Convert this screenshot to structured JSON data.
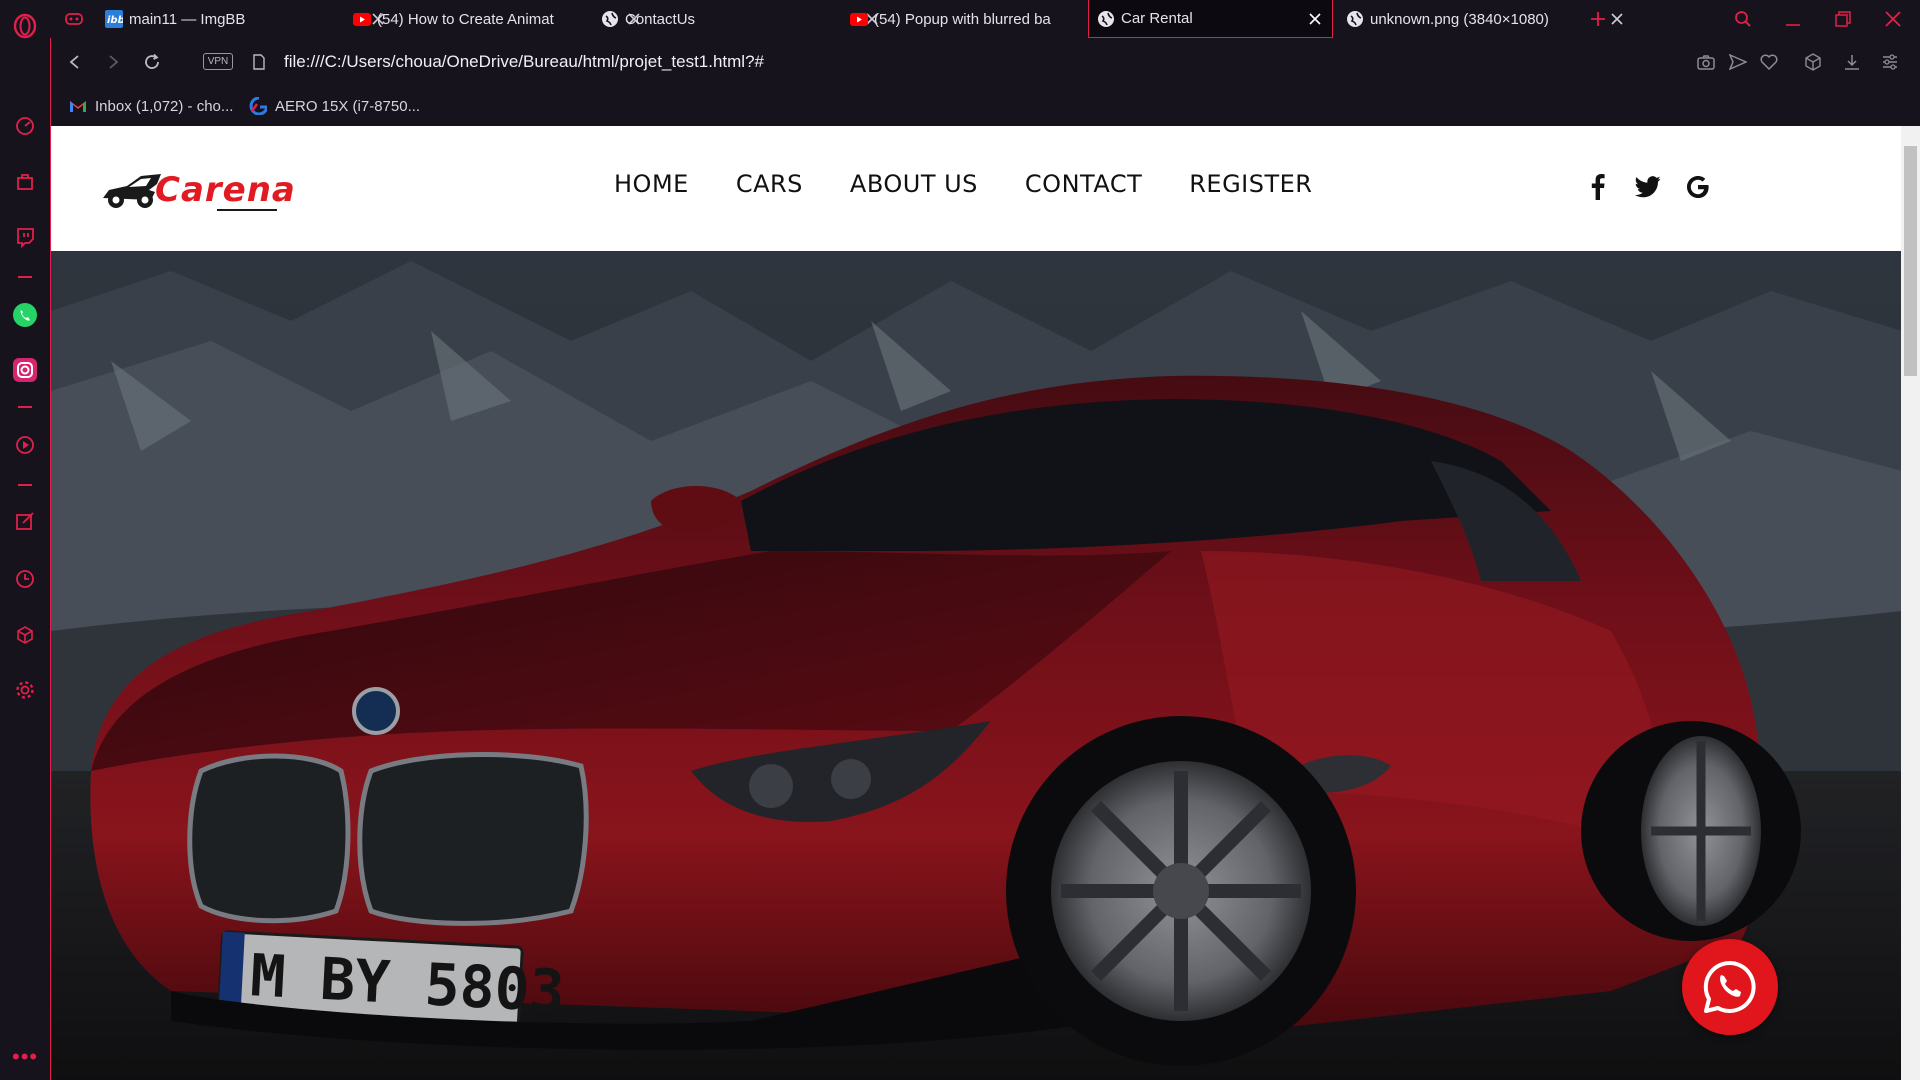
{
  "browser": {
    "tabs": [
      {
        "title": "main11 — ImgBB",
        "icon": "imgbb-icon"
      },
      {
        "title": "(54) How to Create Animat",
        "icon": "youtube-icon"
      },
      {
        "title": "ContactUs",
        "icon": "globe-icon"
      },
      {
        "title": "(54) Popup with blurred ba",
        "icon": "youtube-icon"
      },
      {
        "title": "Car Rental",
        "icon": "globe-icon",
        "active": true
      },
      {
        "title": "unknown.png (3840×1080)",
        "icon": "globe-icon"
      }
    ],
    "url": "file:///C:/Users/choua/OneDrive/Bureau/html/projet_test1.html?#",
    "vpn_label": "VPN",
    "bookmarks": [
      {
        "label": "Inbox (1,072) - cho...",
        "icon": "gmail-icon"
      },
      {
        "label": "AERO 15X (i7-8750...",
        "icon": "gigabyte-icon"
      }
    ],
    "accent_color": "#e0204a"
  },
  "site": {
    "logo_text": "Carena",
    "menu": [
      "HOME",
      "CARS",
      "ABOUT US",
      "CONTACT",
      "REGISTER"
    ],
    "social": [
      "facebook-icon",
      "twitter-icon",
      "google-icon"
    ],
    "hero_image": "red sports car in front of snowy mountains",
    "license_plate": "M BY 5803",
    "brand_color": "#e21b23"
  }
}
